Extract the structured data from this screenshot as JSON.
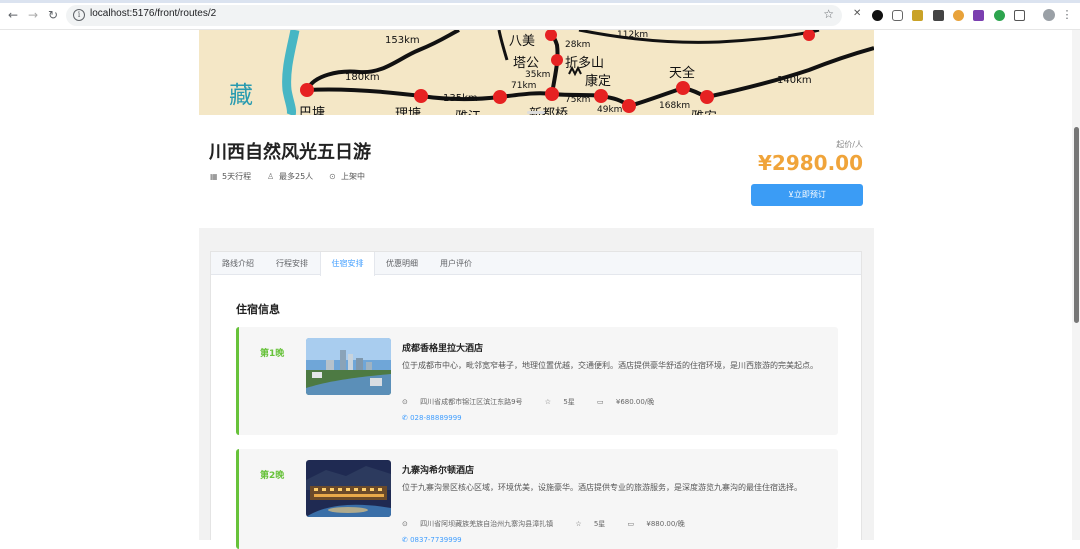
{
  "browser": {
    "url": "localhost:5176/front/routes/2"
  },
  "map": {
    "labels": {
      "zang": "藏",
      "bamei": "八美",
      "tagong": "塔公",
      "zheduoshan": "折多山",
      "kangding": "康定",
      "tianquan": "天全",
      "xindu": "新都桥",
      "yajiang": "雅江",
      "litang": "理塘",
      "batang": "巴塘",
      "lushan": "雅安"
    },
    "distances": {
      "d153": "153km",
      "d180": "180km",
      "d135": "135km",
      "d71": "71km",
      "d28": "28km",
      "d35": "35km",
      "d75": "75km",
      "d49": "49km",
      "d168": "168km",
      "d112": "112km",
      "d140": "140km"
    }
  },
  "route": {
    "title": "川西自然风光五日游",
    "meta": {
      "days": "5天行程",
      "capacity": "最多25人",
      "status": "上架中"
    },
    "price_label": "起价/人",
    "price": "¥2980.00",
    "book_label": "立即预订"
  },
  "tabs": [
    {
      "label": "路线介绍"
    },
    {
      "label": "行程安排"
    },
    {
      "label": "住宿安排"
    },
    {
      "label": "优惠明细"
    },
    {
      "label": "用户评价"
    }
  ],
  "active_tab": "住宿安排",
  "accommodation": {
    "section_title": "住宿信息",
    "hotels": [
      {
        "night": "第1晚",
        "name": "成都香格里拉大酒店",
        "desc": "位于成都市中心，毗邻宽窄巷子，地理位置优越，交通便利。酒店提供豪华舒适的住宿环境，是川西旅游的完美起点。",
        "address": "四川省成都市锦江区滨江东路9号",
        "stars": "5星",
        "price": "¥680.00/晚",
        "phone": "028-88889999"
      },
      {
        "night": "第2晚",
        "name": "九寨沟希尔顿酒店",
        "desc": "位于九寨沟景区核心区域，环境优美，设施豪华。酒店提供专业的旅游服务，是深度游览九寨沟的最佳住宿选择。",
        "address": "四川省阿坝藏族羌族自治州九寨沟县漳扎镇",
        "stars": "5星",
        "price": "¥880.00/晚",
        "phone": "0837-7739999"
      }
    ]
  },
  "colors": {
    "accent": "#409eff",
    "price": "#f0a43a",
    "night": "#67c23a",
    "button": "#3b9cf5"
  }
}
